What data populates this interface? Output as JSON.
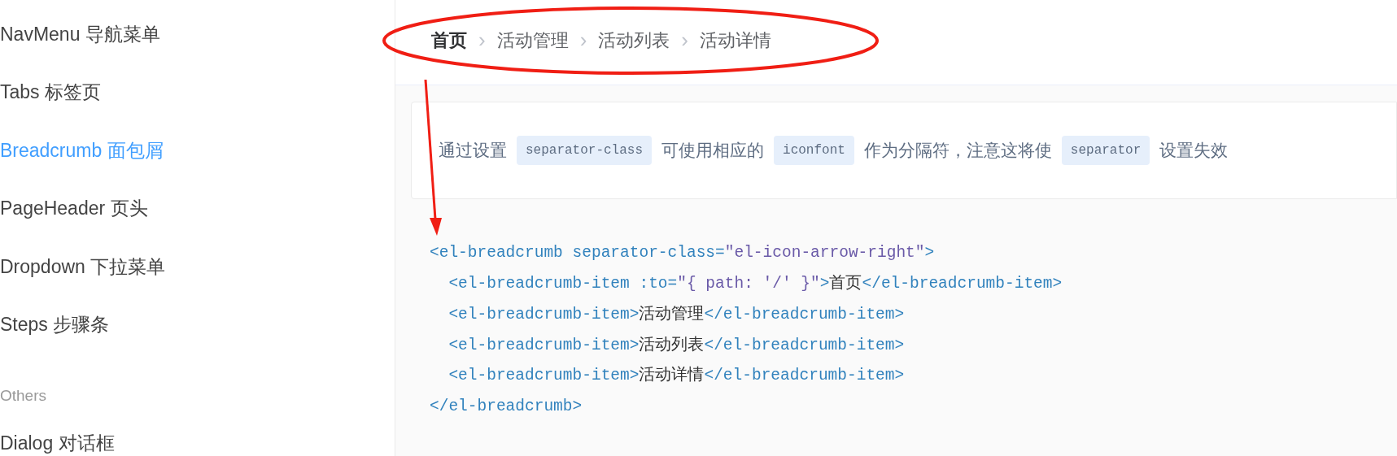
{
  "sidebar": {
    "items": [
      {
        "kind": "item",
        "label": "NavMenu 导航菜单",
        "selected": false
      },
      {
        "kind": "item",
        "label": "Tabs 标签页",
        "selected": false
      },
      {
        "kind": "item",
        "label": "Breadcrumb 面包屑",
        "selected": true
      },
      {
        "kind": "item",
        "label": "PageHeader 页头",
        "selected": false
      },
      {
        "kind": "item",
        "label": "Dropdown 下拉菜单",
        "selected": false
      },
      {
        "kind": "item",
        "label": "Steps 步骤条",
        "selected": false
      },
      {
        "kind": "group",
        "label": "Others"
      },
      {
        "kind": "item",
        "label": "Dialog 对话框",
        "selected": false
      }
    ]
  },
  "breadcrumb": {
    "items": [
      {
        "label": "首页",
        "kind": "link",
        "separator": "›"
      },
      {
        "label": "活动管理",
        "kind": "plain",
        "separator": "›"
      },
      {
        "label": "活动列表",
        "kind": "plain",
        "separator": "›"
      },
      {
        "label": "活动详情",
        "kind": "plain"
      }
    ]
  },
  "tip": {
    "segments": [
      {
        "kind": "text",
        "text": "通过设置"
      },
      {
        "kind": "code",
        "text": "separator-class"
      },
      {
        "kind": "text",
        "text": "可使用相应的"
      },
      {
        "kind": "code",
        "text": "iconfont"
      },
      {
        "kind": "text",
        "text": "作为分隔符，注意这将使"
      },
      {
        "kind": "code",
        "text": "separator"
      },
      {
        "kind": "text",
        "text": "设置失效"
      }
    ]
  },
  "code": {
    "lines": [
      [
        {
          "kind": "tag",
          "text": "<el-breadcrumb separator-class="
        },
        {
          "kind": "string",
          "text": "\"el-icon-arrow-right\""
        },
        {
          "kind": "tag",
          "text": ">"
        }
      ],
      [
        {
          "kind": "tag",
          "text": "  <el-breadcrumb-item :to="
        },
        {
          "kind": "string",
          "text": "\"{ path: '/' }\""
        },
        {
          "kind": "tag",
          "text": ">"
        },
        {
          "kind": "text",
          "text": "首页"
        },
        {
          "kind": "tag",
          "text": "</el-breadcrumb-item>"
        }
      ],
      [
        {
          "kind": "tag",
          "text": "  <el-breadcrumb-item>"
        },
        {
          "kind": "text",
          "text": "活动管理"
        },
        {
          "kind": "tag",
          "text": "</el-breadcrumb-item>"
        }
      ],
      [
        {
          "kind": "tag",
          "text": "  <el-breadcrumb-item>"
        },
        {
          "kind": "text",
          "text": "活动列表"
        },
        {
          "kind": "tag",
          "text": "</el-breadcrumb-item>"
        }
      ],
      [
        {
          "kind": "tag",
          "text": "  <el-breadcrumb-item>"
        },
        {
          "kind": "text",
          "text": "活动详情"
        },
        {
          "kind": "tag",
          "text": "</el-breadcrumb-item>"
        }
      ],
      [
        {
          "kind": "tag",
          "text": "</el-breadcrumb>"
        }
      ]
    ]
  }
}
